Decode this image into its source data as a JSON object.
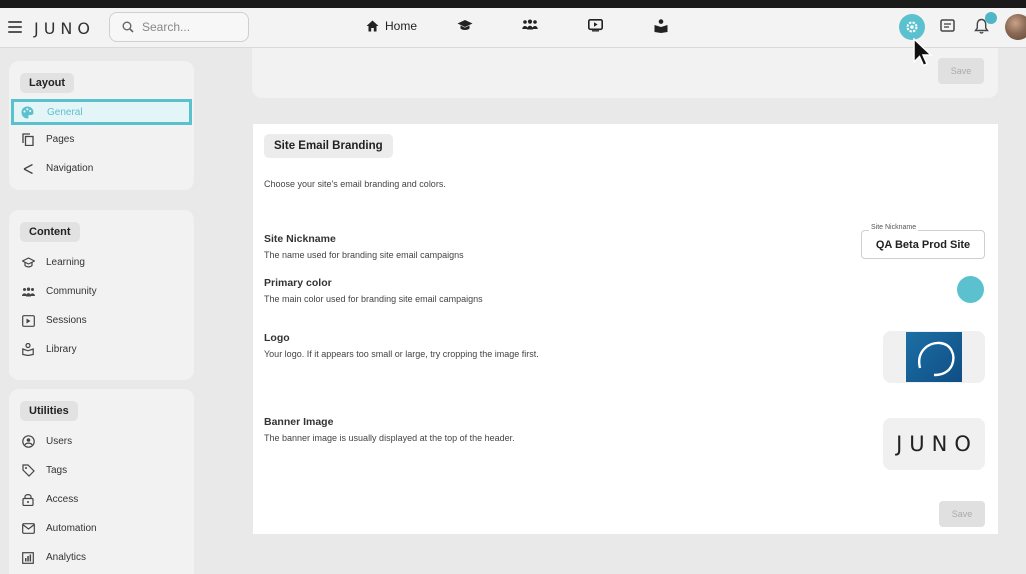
{
  "app": {
    "logo_text": "JUNO"
  },
  "search": {
    "placeholder": "Search..."
  },
  "topnav": {
    "home_label": "Home"
  },
  "sidebar": {
    "layout": {
      "title": "Layout",
      "items": [
        {
          "label": "General",
          "icon": "palette-icon"
        },
        {
          "label": "Pages",
          "icon": "pages-icon"
        },
        {
          "label": "Navigation",
          "icon": "share-icon"
        }
      ]
    },
    "content": {
      "title": "Content",
      "items": [
        {
          "label": "Learning",
          "icon": "graduation-cap-icon"
        },
        {
          "label": "Community",
          "icon": "people-icon"
        },
        {
          "label": "Sessions",
          "icon": "sessions-icon"
        },
        {
          "label": "Library",
          "icon": "book-reader-icon"
        }
      ]
    },
    "utilities": {
      "title": "Utilities",
      "items": [
        {
          "label": "Users",
          "icon": "users-icon"
        },
        {
          "label": "Tags",
          "icon": "tag-icon"
        },
        {
          "label": "Access",
          "icon": "lock-icon"
        },
        {
          "label": "Automation",
          "icon": "mail-icon"
        },
        {
          "label": "Analytics",
          "icon": "analytics-icon"
        }
      ]
    }
  },
  "top_card": {
    "save_label": "Save"
  },
  "branding": {
    "title": "Site Email Branding",
    "description": "Choose your site's email branding and colors.",
    "nickname": {
      "title": "Site Nickname",
      "description": "The name used for branding site email campaigns",
      "field_label": "Site Nickname",
      "value": "QA Beta Prod Site"
    },
    "primary_color": {
      "title": "Primary color",
      "description": "The main color used for branding site email campaigns",
      "value": "#5bc1cf"
    },
    "logo": {
      "title": "Logo",
      "description": "Your logo. If it appears too small or large, try cropping the image first."
    },
    "banner": {
      "title": "Banner Image",
      "description": "The banner image is usually displayed at the top of the header.",
      "image_text": "JUNO"
    },
    "save_label": "Save"
  },
  "colors": {
    "accent": "#5bc1cf"
  }
}
